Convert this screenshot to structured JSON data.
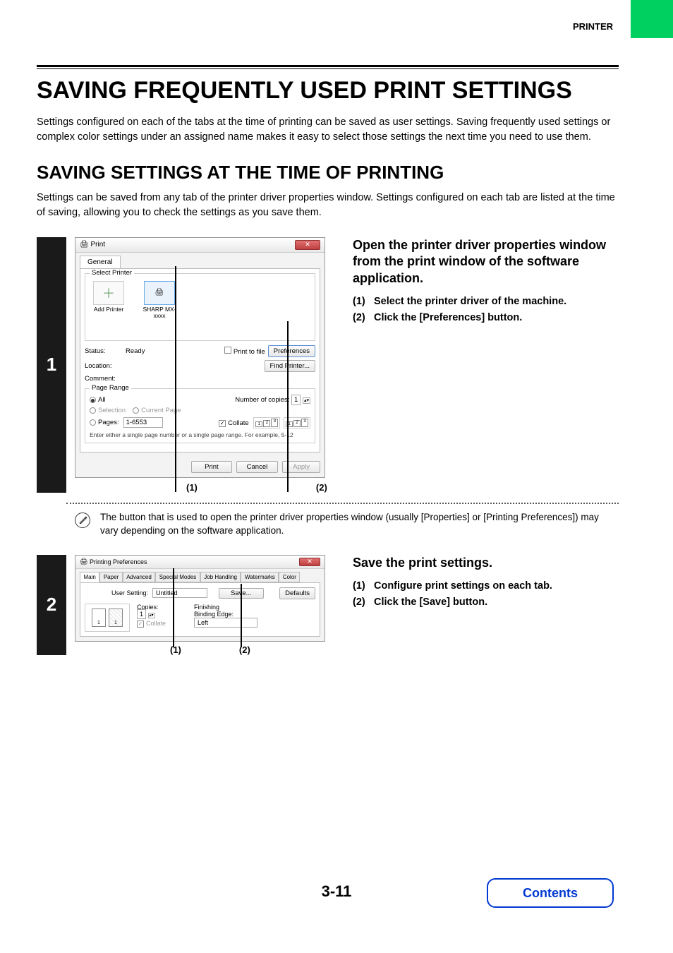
{
  "header": {
    "section": "PRINTER"
  },
  "h1": "SAVING FREQUENTLY USED PRINT SETTINGS",
  "intro": "Settings configured on each of the tabs at the time of printing can be saved as user settings. Saving frequently used settings or complex color settings under an assigned name makes it easy to select those settings the next time you need to use them.",
  "h2": "SAVING SETTINGS AT THE TIME OF PRINTING",
  "sub_intro": "Settings can be saved from any tab of the printer driver properties window. Settings configured on each tab are listed at the time of saving, allowing you to check the settings as you save them.",
  "step1": {
    "num": "1",
    "title": "Open the printer driver properties window from the print window of the software application.",
    "items": [
      {
        "num": "(1)",
        "text": "Select the printer driver of the machine."
      },
      {
        "num": "(2)",
        "text": "Click the [Preferences] button."
      }
    ],
    "callouts": {
      "a": "(1)",
      "b": "(2)"
    },
    "dialog": {
      "title": "Print",
      "tab": "General",
      "group_printer": "Select Printer",
      "add_printer": "Add Printer",
      "sharp": "SHARP MX-xxxx",
      "status_k": "Status:",
      "status_v": "Ready",
      "location_k": "Location:",
      "comment_k": "Comment:",
      "print_to_file": "Print to file",
      "preferences_btn": "Preferences",
      "find_printer_btn": "Find Printer...",
      "group_range": "Page Range",
      "all": "All",
      "selection": "Selection",
      "current_page": "Current Page",
      "pages": "Pages:",
      "pages_val": "1-6553",
      "pages_hint": "Enter either a single page number or a single page range.  For example, 5-12",
      "num_copies_k": "Number of copies:",
      "num_copies_v": "1",
      "collate": "Collate",
      "print_btn": "Print",
      "cancel_btn": "Cancel",
      "apply_btn": "Apply"
    }
  },
  "note1": "The button that is used to open the printer driver properties window (usually [Properties] or [Printing Preferences]) may vary depending on the software application.",
  "step2": {
    "num": "2",
    "title": "Save the print settings.",
    "items": [
      {
        "num": "(1)",
        "text": "Configure print settings on each tab."
      },
      {
        "num": "(2)",
        "text": "Click the [Save] button."
      }
    ],
    "callouts": {
      "a": "(1)",
      "b": "(2)"
    },
    "dialog": {
      "title": "Printing Preferences",
      "tabs": [
        "Main",
        "Paper",
        "Advanced",
        "Special Modes",
        "Job Handling",
        "Watermarks",
        "Color"
      ],
      "user_setting_k": "User Setting:",
      "user_setting_v": "Untitled",
      "save_btn": "Save...",
      "defaults_btn": "Defaults",
      "copies_k": "Copies:",
      "copies_v": "1",
      "collate": "Collate",
      "finishing_k": "Finishing",
      "binding_k": "Binding Edge:",
      "binding_v": "Left"
    }
  },
  "page_number": "3-11",
  "contents_btn": "Contents"
}
